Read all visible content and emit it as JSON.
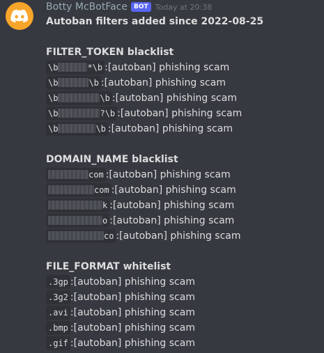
{
  "message": {
    "author": "Botty McBotFace",
    "bot_tag": "BOT",
    "timestamp": "Today at 20:38",
    "intro": "Autoban filters added since 2022-08-25",
    "avatar_icon": "discord-logo-icon",
    "avatar_color": "#f9a52b"
  },
  "sections": {
    "filter_token": {
      "title": "FILTER_TOKEN blacklist",
      "rules": [
        {
          "prefix": "\\b",
          "suffix": "*\\b",
          "action": "[autoban] phishing scam"
        },
        {
          "prefix": "\\b",
          "suffix": "\\b",
          "action": "[autoban] phishing scam"
        },
        {
          "prefix": "\\b",
          "suffix": "\\b",
          "action": "[autoban] phishing scam"
        },
        {
          "prefix": "\\b",
          "suffix": "?\\b",
          "action": "[autoban] phishing scam"
        },
        {
          "prefix": "\\b",
          "suffix": "\\b",
          "action": "[autoban] phishing scam"
        }
      ]
    },
    "domain_name": {
      "title": "DOMAIN_NAME blacklist",
      "rules": [
        {
          "suffix": "com",
          "action": "[autoban] phishing scam"
        },
        {
          "suffix": "com",
          "action": "[autoban] phishing scam"
        },
        {
          "suffix": "k",
          "action": "[autoban] phishing scam"
        },
        {
          "suffix": "o",
          "action": "[autoban] phishing scam"
        },
        {
          "suffix": "co",
          "action": "[autoban] phishing scam"
        }
      ]
    },
    "file_format": {
      "title": "FILE_FORMAT whitelist",
      "rules": [
        {
          "value": ".3gp",
          "action": "[autoban] phishing scam"
        },
        {
          "value": ".3g2",
          "action": "[autoban] phishing scam"
        },
        {
          "value": ".avi",
          "action": "[autoban] phishing scam"
        },
        {
          "value": ".bmp",
          "action": "[autoban] phishing scam"
        },
        {
          "value": ".gif",
          "action": "[autoban] phishing scam"
        }
      ]
    }
  },
  "colors": {
    "background": "#36393f",
    "username": "#99aab5",
    "bot_tag": "#5865f2",
    "code_background": "#2f3136"
  }
}
